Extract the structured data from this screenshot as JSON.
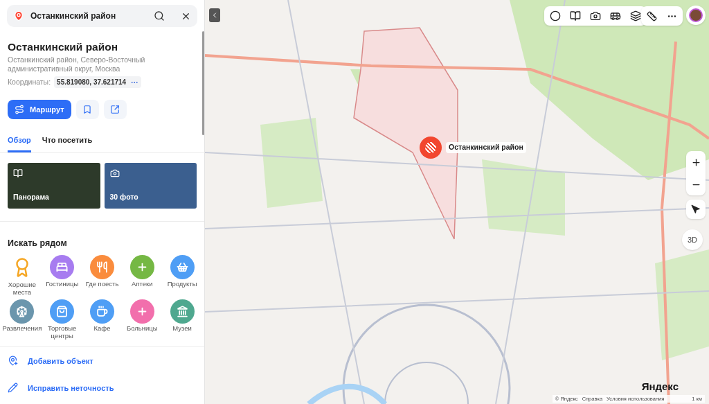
{
  "search": {
    "value": "Останкинский район"
  },
  "place": {
    "title": "Останкинский район",
    "address": "Останкинский район, Северо-Восточный административный округ, Москва",
    "coords_label": "Координаты:",
    "coords": "55.819080, 37.621714"
  },
  "route_button": "Маршрут",
  "tabs": [
    {
      "label": "Обзор",
      "selected": true
    },
    {
      "label": "Что посетить",
      "selected": false
    }
  ],
  "media": [
    {
      "kind": "panorama",
      "label": "Панорама"
    },
    {
      "kind": "photos",
      "label": "30 фото"
    }
  ],
  "nearby": {
    "title": "Искать рядом",
    "categories": [
      {
        "kind": "top",
        "label": "Хорошие места",
        "color": "#f5a623"
      },
      {
        "kind": "hotel",
        "label": "Гостиницы",
        "color": "#a77cf0"
      },
      {
        "kind": "food",
        "label": "Где поесть",
        "color": "#fa8c3d"
      },
      {
        "kind": "pharmacy",
        "label": "Аптеки",
        "color": "#75b844"
      },
      {
        "kind": "grocery",
        "label": "Продукты",
        "color": "#4f9ef5"
      },
      {
        "kind": "fun",
        "label": "Развлечения",
        "color": "#6b96ad"
      },
      {
        "kind": "mall",
        "label": "Торговые центры",
        "color": "#4f9ef5"
      },
      {
        "kind": "cafe",
        "label": "Кафе",
        "color": "#4f9ef5"
      },
      {
        "kind": "hospital",
        "label": "Больницы",
        "color": "#f26fac"
      },
      {
        "kind": "museum",
        "label": "Музеи",
        "color": "#4fa88f"
      }
    ]
  },
  "actions": [
    {
      "kind": "add",
      "label": "Добавить объект"
    },
    {
      "kind": "edit",
      "label": "Исправить неточность"
    }
  ],
  "map": {
    "pin_label": "Останкинский район",
    "mode_button": "3D",
    "logo": "Яндекс",
    "attribution": [
      "© Яндекс",
      "Справка",
      "Условия использования"
    ],
    "scale": "1 км"
  }
}
